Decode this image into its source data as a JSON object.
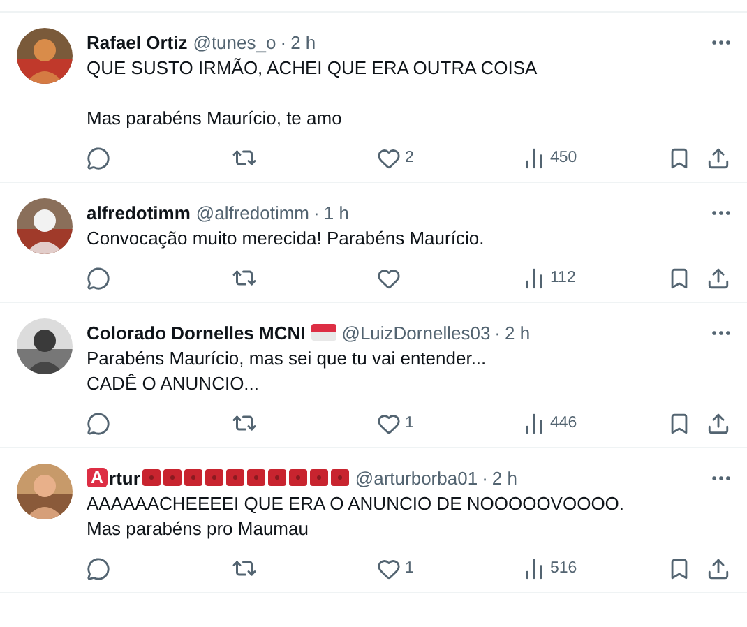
{
  "tweets": [
    {
      "name": "Rafael Ortiz",
      "handle": "@tunes_o",
      "separator": "·",
      "time": "2 h",
      "paragraphs": [
        [
          "QUE SUSTO IRMÃO, ACHEI QUE ERA OUTRA COISA"
        ],
        [
          "Mas parabéns Maurício, te amo"
        ]
      ],
      "likes": "2",
      "views": "450"
    },
    {
      "name": "alfredotimm",
      "handle": "@alfredotimm",
      "separator": "·",
      "time": "1 h",
      "paragraphs": [
        [
          "Convocação muito merecida! Parabéns Maurício."
        ]
      ],
      "views": "112"
    },
    {
      "name": "Colorado Dornelles MCNI",
      "handle": "@LuizDornelles03",
      "separator": "·",
      "time": "2 h",
      "badges": [
        {
          "kind": "flag"
        }
      ],
      "paragraphs": [
        [
          "Parabéns Maurício, mas sei que tu vai entender...",
          "CADÊ O ANUNCIO..."
        ]
      ],
      "likes": "1",
      "views": "446"
    },
    {
      "name_prefix": "A",
      "name": "rtur",
      "handle": "@arturborba01",
      "separator": "·",
      "time": "2 h",
      "badges": [
        {
          "kind": "square"
        },
        {
          "kind": "square"
        },
        {
          "kind": "square"
        },
        {
          "kind": "square"
        },
        {
          "kind": "square"
        },
        {
          "kind": "square"
        },
        {
          "kind": "square"
        },
        {
          "kind": "square"
        },
        {
          "kind": "square"
        },
        {
          "kind": "square"
        }
      ],
      "paragraphs": [
        [
          "AAAAAACHEEEEI QUE ERA O ANUNCIO DE NOOOOOVOOOO.",
          "Mas parabéns pro Maumau"
        ]
      ],
      "likes": "1",
      "views": "516"
    }
  ]
}
